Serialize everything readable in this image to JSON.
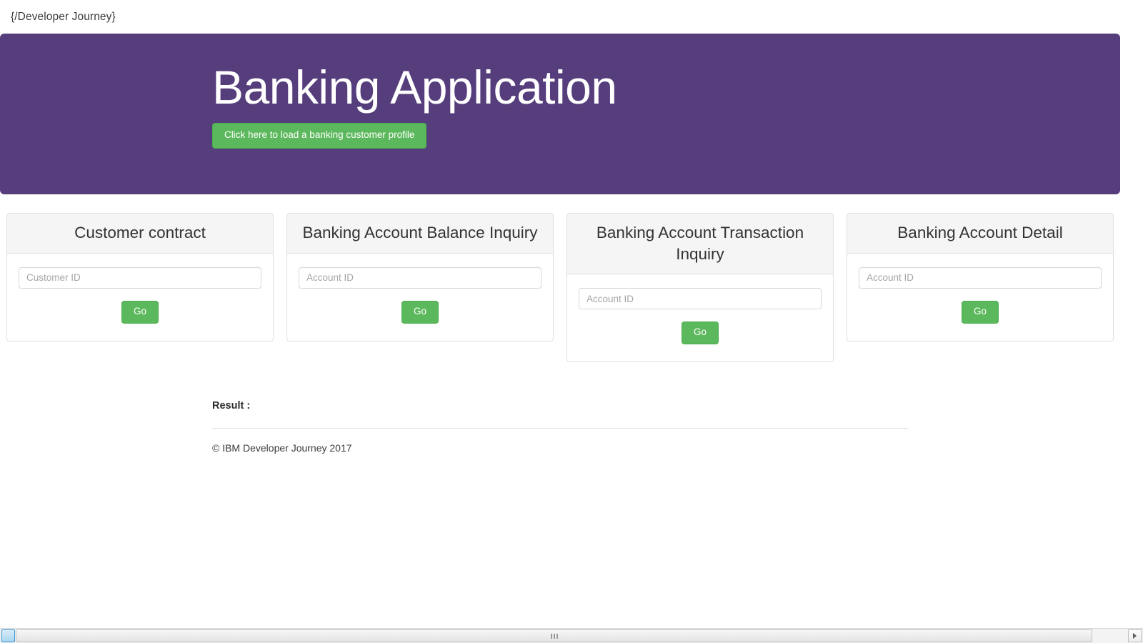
{
  "navbar": {
    "brand": "{/Developer Journey}"
  },
  "hero": {
    "title": "Banking Application",
    "cta_label": "Click here to load a banking customer profile",
    "background_color": "#563d7c",
    "cta_color": "#5cb85c"
  },
  "panels": [
    {
      "title": "Customer contract",
      "input_placeholder": "Customer ID",
      "input_value": "",
      "button_label": "Go"
    },
    {
      "title": "Banking Account Balance Inquiry",
      "input_placeholder": "Account ID",
      "input_value": "",
      "button_label": "Go"
    },
    {
      "title": "Banking Account Transaction Inquiry",
      "input_placeholder": "Account ID",
      "input_value": "",
      "button_label": "Go"
    },
    {
      "title": "Banking Account Detail",
      "input_placeholder": "Account ID",
      "input_value": "",
      "button_label": "Go"
    }
  ],
  "result": {
    "label": "Result :",
    "value": ""
  },
  "footer": {
    "copyright": "© IBM Developer Journey 2017"
  },
  "scrollbar": {
    "left_arrow_icon": "arrow-left-icon",
    "right_arrow_icon": "arrow-right-icon",
    "grip_icon": "scrollbar-grip-icon"
  }
}
